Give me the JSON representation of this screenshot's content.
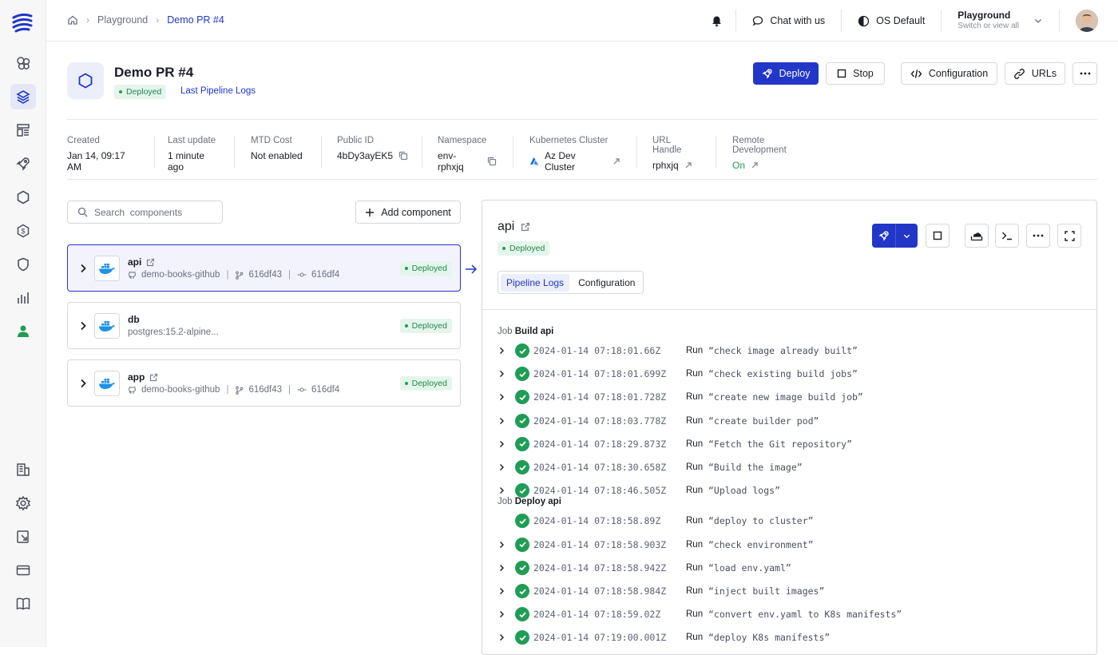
{
  "breadcrumb": [
    "Playground",
    "Demo PR #4"
  ],
  "topbar": {
    "chat": "Chat with us",
    "theme": "OS Default",
    "org_name": "Playground",
    "org_sub": "Switch or view all"
  },
  "env": {
    "title": "Demo PR #4",
    "status": "Deployed",
    "logs_link": "Last Pipeline Logs"
  },
  "actions": {
    "deploy": "Deploy",
    "stop": "Stop",
    "configuration": "Configuration",
    "urls": "URLs"
  },
  "meta": [
    {
      "label": "Created",
      "value": "Jan 14, 09:17 AM"
    },
    {
      "label": "Last update",
      "value": "1 minute ago"
    },
    {
      "label": "MTD Cost",
      "value": "Not enabled"
    },
    {
      "label": "Public ID",
      "value": "4bDy3ayEK5"
    },
    {
      "label": "Namespace",
      "value": "env-rphxjq"
    },
    {
      "label": "Kubernetes Cluster",
      "value": "Az Dev Cluster"
    },
    {
      "label": "URL Handle",
      "value": "rphxjq"
    },
    {
      "label": "Remote Development",
      "value": "On"
    }
  ],
  "search": {
    "placeholder": "Search  components"
  },
  "add_component": "Add component",
  "components": [
    {
      "name": "api",
      "repo": "demo-books-github",
      "branch": "616df43",
      "commit": "616df4",
      "status": "Deployed"
    },
    {
      "name": "db",
      "image": "postgres:15.2-alpine...",
      "status": "Deployed"
    },
    {
      "name": "app",
      "repo": "demo-books-github",
      "branch": "616df43",
      "commit": "616df4",
      "status": "Deployed"
    }
  ],
  "detail": {
    "title": "api",
    "status": "Deployed",
    "tabs": [
      "Pipeline Logs",
      "Configuration"
    ],
    "job_prefix": "Job",
    "jobs": [
      {
        "name": "Build api",
        "steps": [
          {
            "ts": "2024-01-14 07:18:01.66Z",
            "cmd": "“check image already built”"
          },
          {
            "ts": "2024-01-14 07:18:01.699Z",
            "cmd": "“check existing build jobs”"
          },
          {
            "ts": "2024-01-14 07:18:01.728Z",
            "cmd": "“create new image build job”"
          },
          {
            "ts": "2024-01-14 07:18:03.778Z",
            "cmd": "“create builder pod”"
          },
          {
            "ts": "2024-01-14 07:18:29.873Z",
            "cmd": "“Fetch the Git repository”"
          },
          {
            "ts": "2024-01-14 07:18:30.658Z",
            "cmd": "“Build the image”"
          },
          {
            "ts": "2024-01-14 07:18:46.505Z",
            "cmd": "“Upload logs”"
          }
        ]
      },
      {
        "name": "Deploy api",
        "steps": [
          {
            "ts": "2024-01-14 07:18:58.89Z",
            "cmd": "“deploy to cluster”"
          },
          {
            "ts": "2024-01-14 07:18:58.903Z",
            "cmd": "“check environment”"
          },
          {
            "ts": "2024-01-14 07:18:58.942Z",
            "cmd": "“load env.yaml”"
          },
          {
            "ts": "2024-01-14 07:18:58.984Z",
            "cmd": "“inject built images”"
          },
          {
            "ts": "2024-01-14 07:18:59.02Z",
            "cmd": "“convert env.yaml to K8s manifests”"
          },
          {
            "ts": "2024-01-14 07:19:00.001Z",
            "cmd": "“deploy K8s manifests”"
          }
        ]
      }
    ],
    "run_label": "Run"
  },
  "colors": {
    "accent": "#2236c8",
    "success": "#1f9d55",
    "docker": "#1d91e6"
  }
}
